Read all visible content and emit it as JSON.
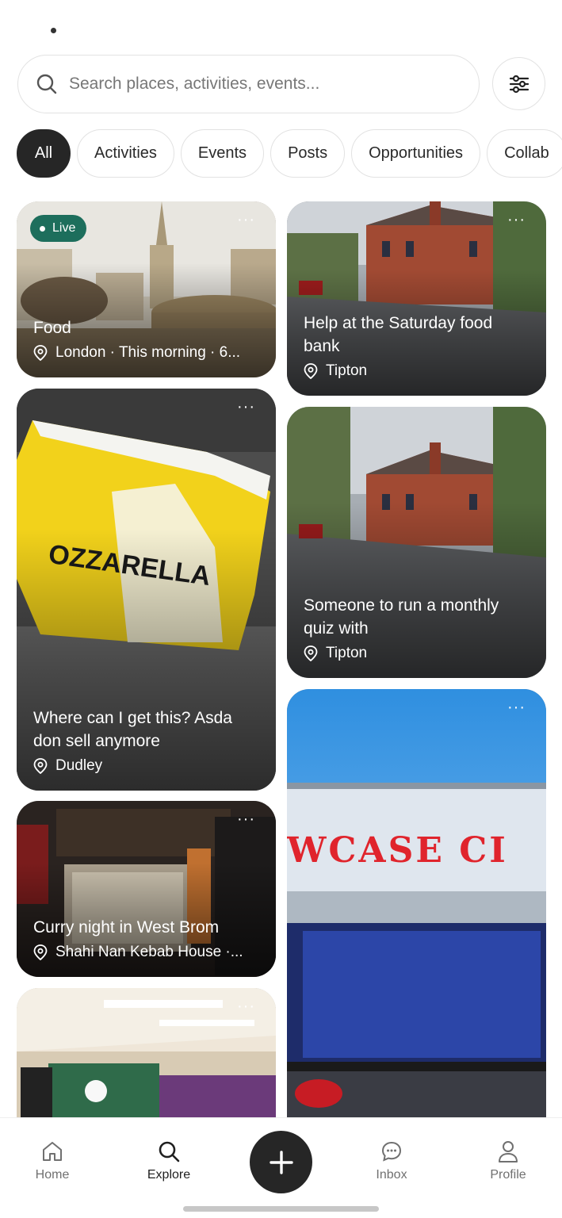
{
  "search": {
    "placeholder": "Search places, activities, events..."
  },
  "chips": [
    {
      "label": "All",
      "active": true
    },
    {
      "label": "Activities",
      "active": false
    },
    {
      "label": "Events",
      "active": false
    },
    {
      "label": "Posts",
      "active": false
    },
    {
      "label": "Opportunities",
      "active": false
    },
    {
      "label": "Collab",
      "active": false
    }
  ],
  "cards": {
    "food": {
      "badge": "Live",
      "title": "Food",
      "location": "London · This morning · 6..."
    },
    "mozzarella": {
      "title": "Where can I get this? Asda don sell anymore",
      "location": "Dudley"
    },
    "curry": {
      "title": "Curry night in West Brom",
      "location": "Shahi Nan Kebab House ·..."
    },
    "foodbank": {
      "title": "Help at the Saturday food bank",
      "location": "Tipton"
    },
    "quiz": {
      "title": "Someone to run a monthly quiz with",
      "location": "Tipton"
    },
    "cinema": {
      "sign_text": "WCASE CI"
    }
  },
  "nav": {
    "home": "Home",
    "explore": "Explore",
    "inbox": "Inbox",
    "profile": "Profile"
  },
  "colors": {
    "accent_dark": "#262626",
    "live_badge": "#1d6e5c"
  }
}
